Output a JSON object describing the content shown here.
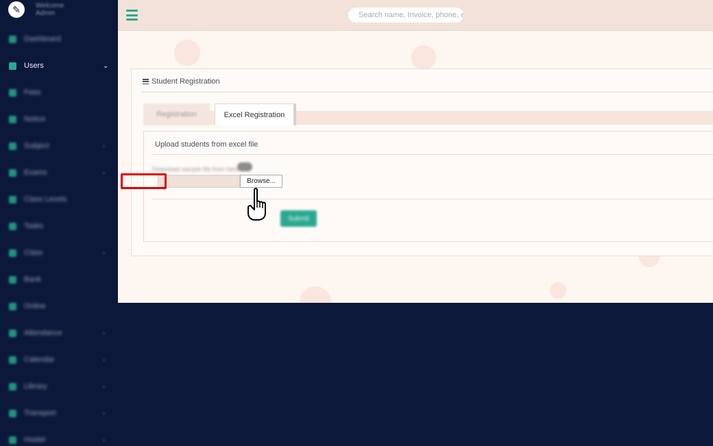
{
  "sidebar": {
    "brand": {
      "line1": "Welcome",
      "line2": "Admin"
    },
    "items": [
      {
        "label": "Dashboard",
        "chevron": ""
      },
      {
        "label": "Users",
        "chevron": "⌄"
      },
      {
        "label": "Fees",
        "chevron": ""
      },
      {
        "label": "Notice",
        "chevron": ""
      },
      {
        "label": "Subject",
        "chevron": "›"
      },
      {
        "label": "Exams",
        "chevron": "›"
      },
      {
        "label": "Class Levels",
        "chevron": ""
      },
      {
        "label": "Tasks",
        "chevron": ""
      },
      {
        "label": "Class",
        "chevron": "›"
      },
      {
        "label": "Bank",
        "chevron": ""
      },
      {
        "label": "Online",
        "chevron": ""
      },
      {
        "label": "Attendance",
        "chevron": "›"
      },
      {
        "label": "Calendar",
        "chevron": "›"
      },
      {
        "label": "Library",
        "chevron": "›"
      },
      {
        "label": "Transport",
        "chevron": "›"
      },
      {
        "label": "Hostel",
        "chevron": "›"
      }
    ]
  },
  "topbar": {
    "search_placeholder": "Search name, Invoice, phone, e"
  },
  "card": {
    "title": "Student Registration"
  },
  "tabs": {
    "inactive": "Registration",
    "active": "Excel Registration"
  },
  "panel": {
    "title": "Upload students from excel file",
    "download_text": "Download sample file from here",
    "browse_label": "Browse...",
    "submit_label": "Submit"
  }
}
